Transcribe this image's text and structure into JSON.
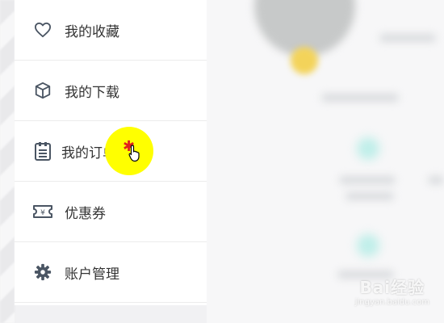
{
  "menu": {
    "items": [
      {
        "label": "我的收藏",
        "icon": "heart-icon"
      },
      {
        "label": "我的下载",
        "icon": "box-icon"
      },
      {
        "label": "我的订单",
        "icon": "clipboard-icon"
      },
      {
        "label": "优惠券",
        "icon": "coupon-icon"
      },
      {
        "label": "账户管理",
        "icon": "gear-icon"
      }
    ]
  },
  "watermark": {
    "brand": "Bai经验",
    "url": "jingyan.baidu.com"
  },
  "colors": {
    "highlight": "#ffff00",
    "icon": "#4a5563",
    "badge": "#f3d35a"
  }
}
